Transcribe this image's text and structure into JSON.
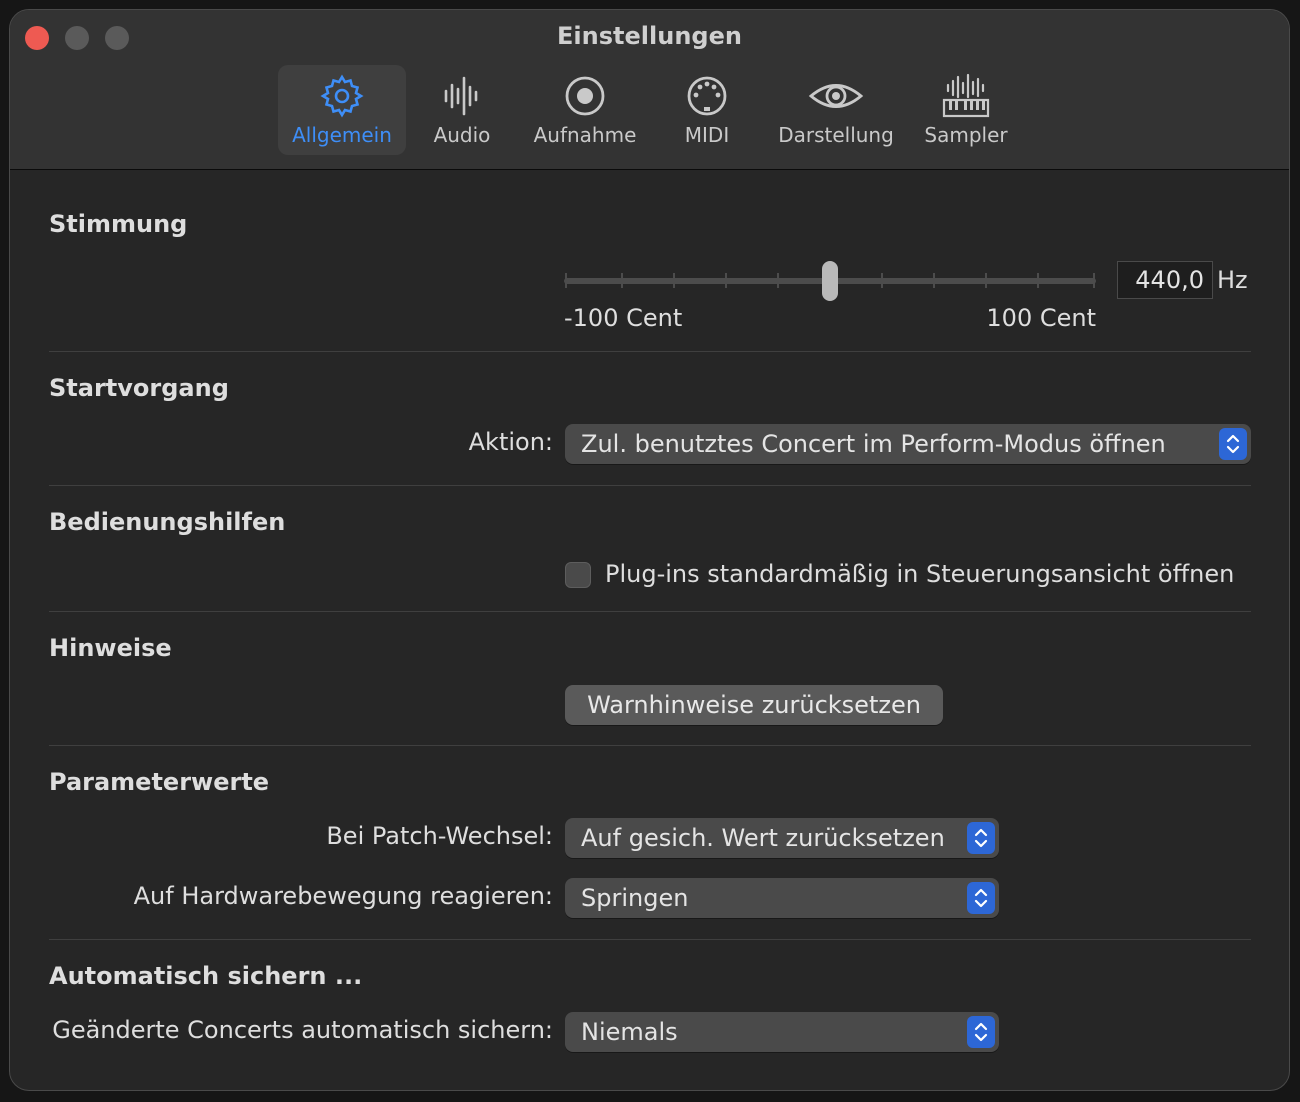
{
  "window": {
    "title": "Einstellungen"
  },
  "tabs": [
    {
      "label": "Allgemein",
      "icon": "gear-icon",
      "active": true
    },
    {
      "label": "Audio",
      "icon": "waveform-icon",
      "active": false
    },
    {
      "label": "Aufnahme",
      "icon": "record-icon",
      "active": false
    },
    {
      "label": "MIDI",
      "icon": "midi-port-icon",
      "active": false
    },
    {
      "label": "Darstellung",
      "icon": "eye-icon",
      "active": false
    },
    {
      "label": "Sampler",
      "icon": "sampler-keyboard-icon",
      "active": false
    }
  ],
  "tuning": {
    "title": "Stimmung",
    "min_label": "-100 Cent",
    "max_label": "100 Cent",
    "slider_position": 0.5,
    "value": "440,0",
    "unit": "Hz"
  },
  "startup": {
    "title": "Startvorgang",
    "action_label": "Aktion:",
    "action_value": "Zul. benutztes Concert im Perform-Modus öffnen"
  },
  "accessibility": {
    "title": "Bedienungshilfen",
    "checkbox_label": "Plug-ins standardmäßig in Steuerungsansicht öffnen",
    "checked": false
  },
  "notices": {
    "title": "Hinweise",
    "reset_button": "Warnhinweise zurücksetzen"
  },
  "parameters": {
    "title": "Parameterwerte",
    "patch_change_label": "Bei Patch-Wechsel:",
    "patch_change_value": "Auf gesich. Wert zurücksetzen",
    "hardware_label": "Auf Hardwarebewegung reagieren:",
    "hardware_value": "Springen"
  },
  "autosave": {
    "title": "Automatisch sichern ...",
    "label": "Geänderte Concerts automatisch sichern:",
    "value": "Niemals"
  },
  "colors": {
    "accent": "#3e8ef7",
    "stepper": "#2d67d6",
    "close": "#ee5a52"
  }
}
